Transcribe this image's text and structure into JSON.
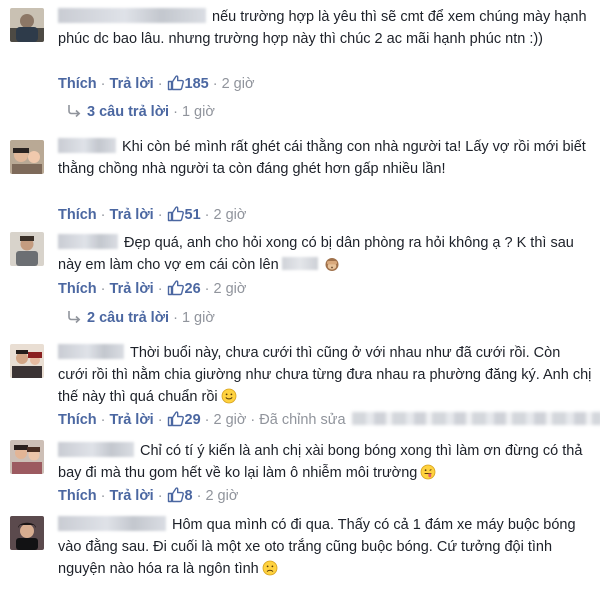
{
  "actions": {
    "like_label": "Thích",
    "reply_label": "Trả lời",
    "separator": "·"
  },
  "comments": [
    {
      "text": "nếu trường hợp là yêu thì sẽ cmt để xem chúng mày hạnh phúc dc bao lâu. nhưng trường hợp này thì chúc 2 ac mãi hạnh phúc ntn :))",
      "likes": "185",
      "time": "2 giờ",
      "replies_label": "3 câu trả lời",
      "replies_time": "1 giờ"
    },
    {
      "text": "Khi còn bé mình rất ghét cái thằng con nhà người ta! Lấy vợ rồi mới biết thằng chồng nhà người ta còn đáng ghét hơn gấp nhiều lần!",
      "likes": "51",
      "time": "2 giờ"
    },
    {
      "text_before": "Đẹp quá, anh cho hỏi xong có bị dân phòng ra hỏi không ạ ? K thì sau này em làm cho vợ em cái còn lên",
      "emoji": "see-no-evil-monkey-icon",
      "likes": "26",
      "time": "2 giờ",
      "replies_label": "2 câu trả lời",
      "replies_time": "1 giờ"
    },
    {
      "text": "Thời buổi này, chưa cưới thì cũng ở với nhau như đã cưới rồi. Còn cưới rồi thì nằm chia giường như chưa từng đưa nhau ra phường đăng ký. Anh chị thế này thì quá chuẩn rồi",
      "emoji": "smile-emoji-icon",
      "likes": "29",
      "time": "2 giờ",
      "edited_label": "Đã chỉnh sửa"
    },
    {
      "text": "Chỉ có tí ý kiến là anh chị xài bong bóng xong thì làm ơn đừng có thả bay đi mà thu gom hết về ko lại làm ô nhiễm môi trường",
      "emoji": "tongue-out-emoji-icon",
      "likes": "8",
      "time": "2 giờ"
    },
    {
      "text": "Hôm qua mình có đi qua. Thấy có cả 1 đám xe máy buộc bóng vào đằng sau. Đi cuối là một xe oto trắng cũng buộc bóng. Cứ tưởng đội tình nguyện nào hóa ra là ngôn tình",
      "emoji": "frown-emoji-icon"
    }
  ],
  "colors": {
    "link": "#4b67a1",
    "meta": "#90949c",
    "text": "#1d2129"
  }
}
